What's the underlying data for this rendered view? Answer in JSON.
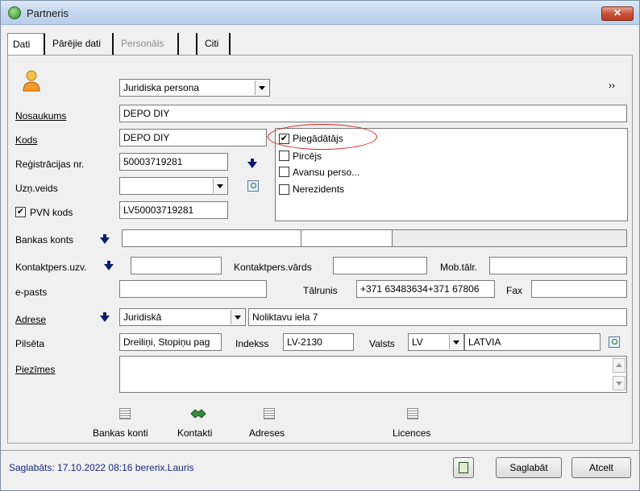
{
  "window": {
    "title": "Partneris",
    "close_label": "✕"
  },
  "tabs": [
    {
      "label": "Dati",
      "state": "active"
    },
    {
      "label": "Pārējie dati",
      "state": "normal"
    },
    {
      "label": "Personāls",
      "state": "disabled"
    },
    {
      "label": "",
      "state": "normal"
    },
    {
      "label": "Citi",
      "state": "normal"
    }
  ],
  "header": {
    "person_type": "Juridiska persona",
    "more_label": "››"
  },
  "fields": {
    "nosaukums_label": "Nosaukums",
    "nosaukums_value": "DEPO DIY",
    "kods_label": "Kods",
    "kods_value": "DEPO DIY",
    "reg_label": "Reģistrācijas nr.",
    "reg_value": "50003719281",
    "uzn_label": "Uzņ.veids",
    "uzn_value": "",
    "pvn_label": "PVN kods",
    "pvn_checked": "✔",
    "pvn_value": "LV50003719281",
    "bank_label": "Bankas konts",
    "bank_value1": "",
    "bank_value2": "",
    "kontakt_uzv_label": "Kontaktpers.uzv.",
    "kontakt_uzv_value": "",
    "kontakt_vards_label": "Kontaktpers.vārds",
    "kontakt_vards_value": "",
    "mob_label": "Mob.tālr.",
    "mob_value": "",
    "epasts_label": "e-pasts",
    "epasts_value": "",
    "talrunis_label": "Tālrunis",
    "talrunis_value": "+371 63483634+371 67806",
    "fax_label": "Fax",
    "fax_value": "",
    "adrese_label": "Adrese",
    "adrese_type": "Juridiskā",
    "adrese_value": "Noliktavu iela 7",
    "pilseta_label": "Pilsēta",
    "pilseta_value": "Dreiliņi, Stopiņu pag",
    "indekss_label": "Indekss",
    "indekss_value": "LV-2130",
    "valsts_label": "Valsts",
    "valsts_code": "LV",
    "valsts_name": "LATVIA",
    "piezimes_label": "Piezīmes",
    "piezimes_value": ""
  },
  "roles": [
    {
      "label": "Piegādātājs",
      "mark": "✔"
    },
    {
      "label": "Pircējs",
      "mark": ""
    },
    {
      "label": "Avansu perso...",
      "mark": ""
    },
    {
      "label": "Nerezidents",
      "mark": ""
    }
  ],
  "bottom_links": [
    {
      "label": "Bankas konti"
    },
    {
      "label": "Kontakti"
    },
    {
      "label": "Adreses"
    },
    {
      "label": "Licences"
    }
  ],
  "footer": {
    "status": "Saglabāts: 17.10.2022 08:16 bererix.Lauris",
    "save_label": "Saglabāt",
    "cancel_label": "Atcelt"
  },
  "colors": {
    "status_text": "#1b2a80",
    "highlight_oval": "#d42020",
    "arrow": "#0a1f6b"
  }
}
